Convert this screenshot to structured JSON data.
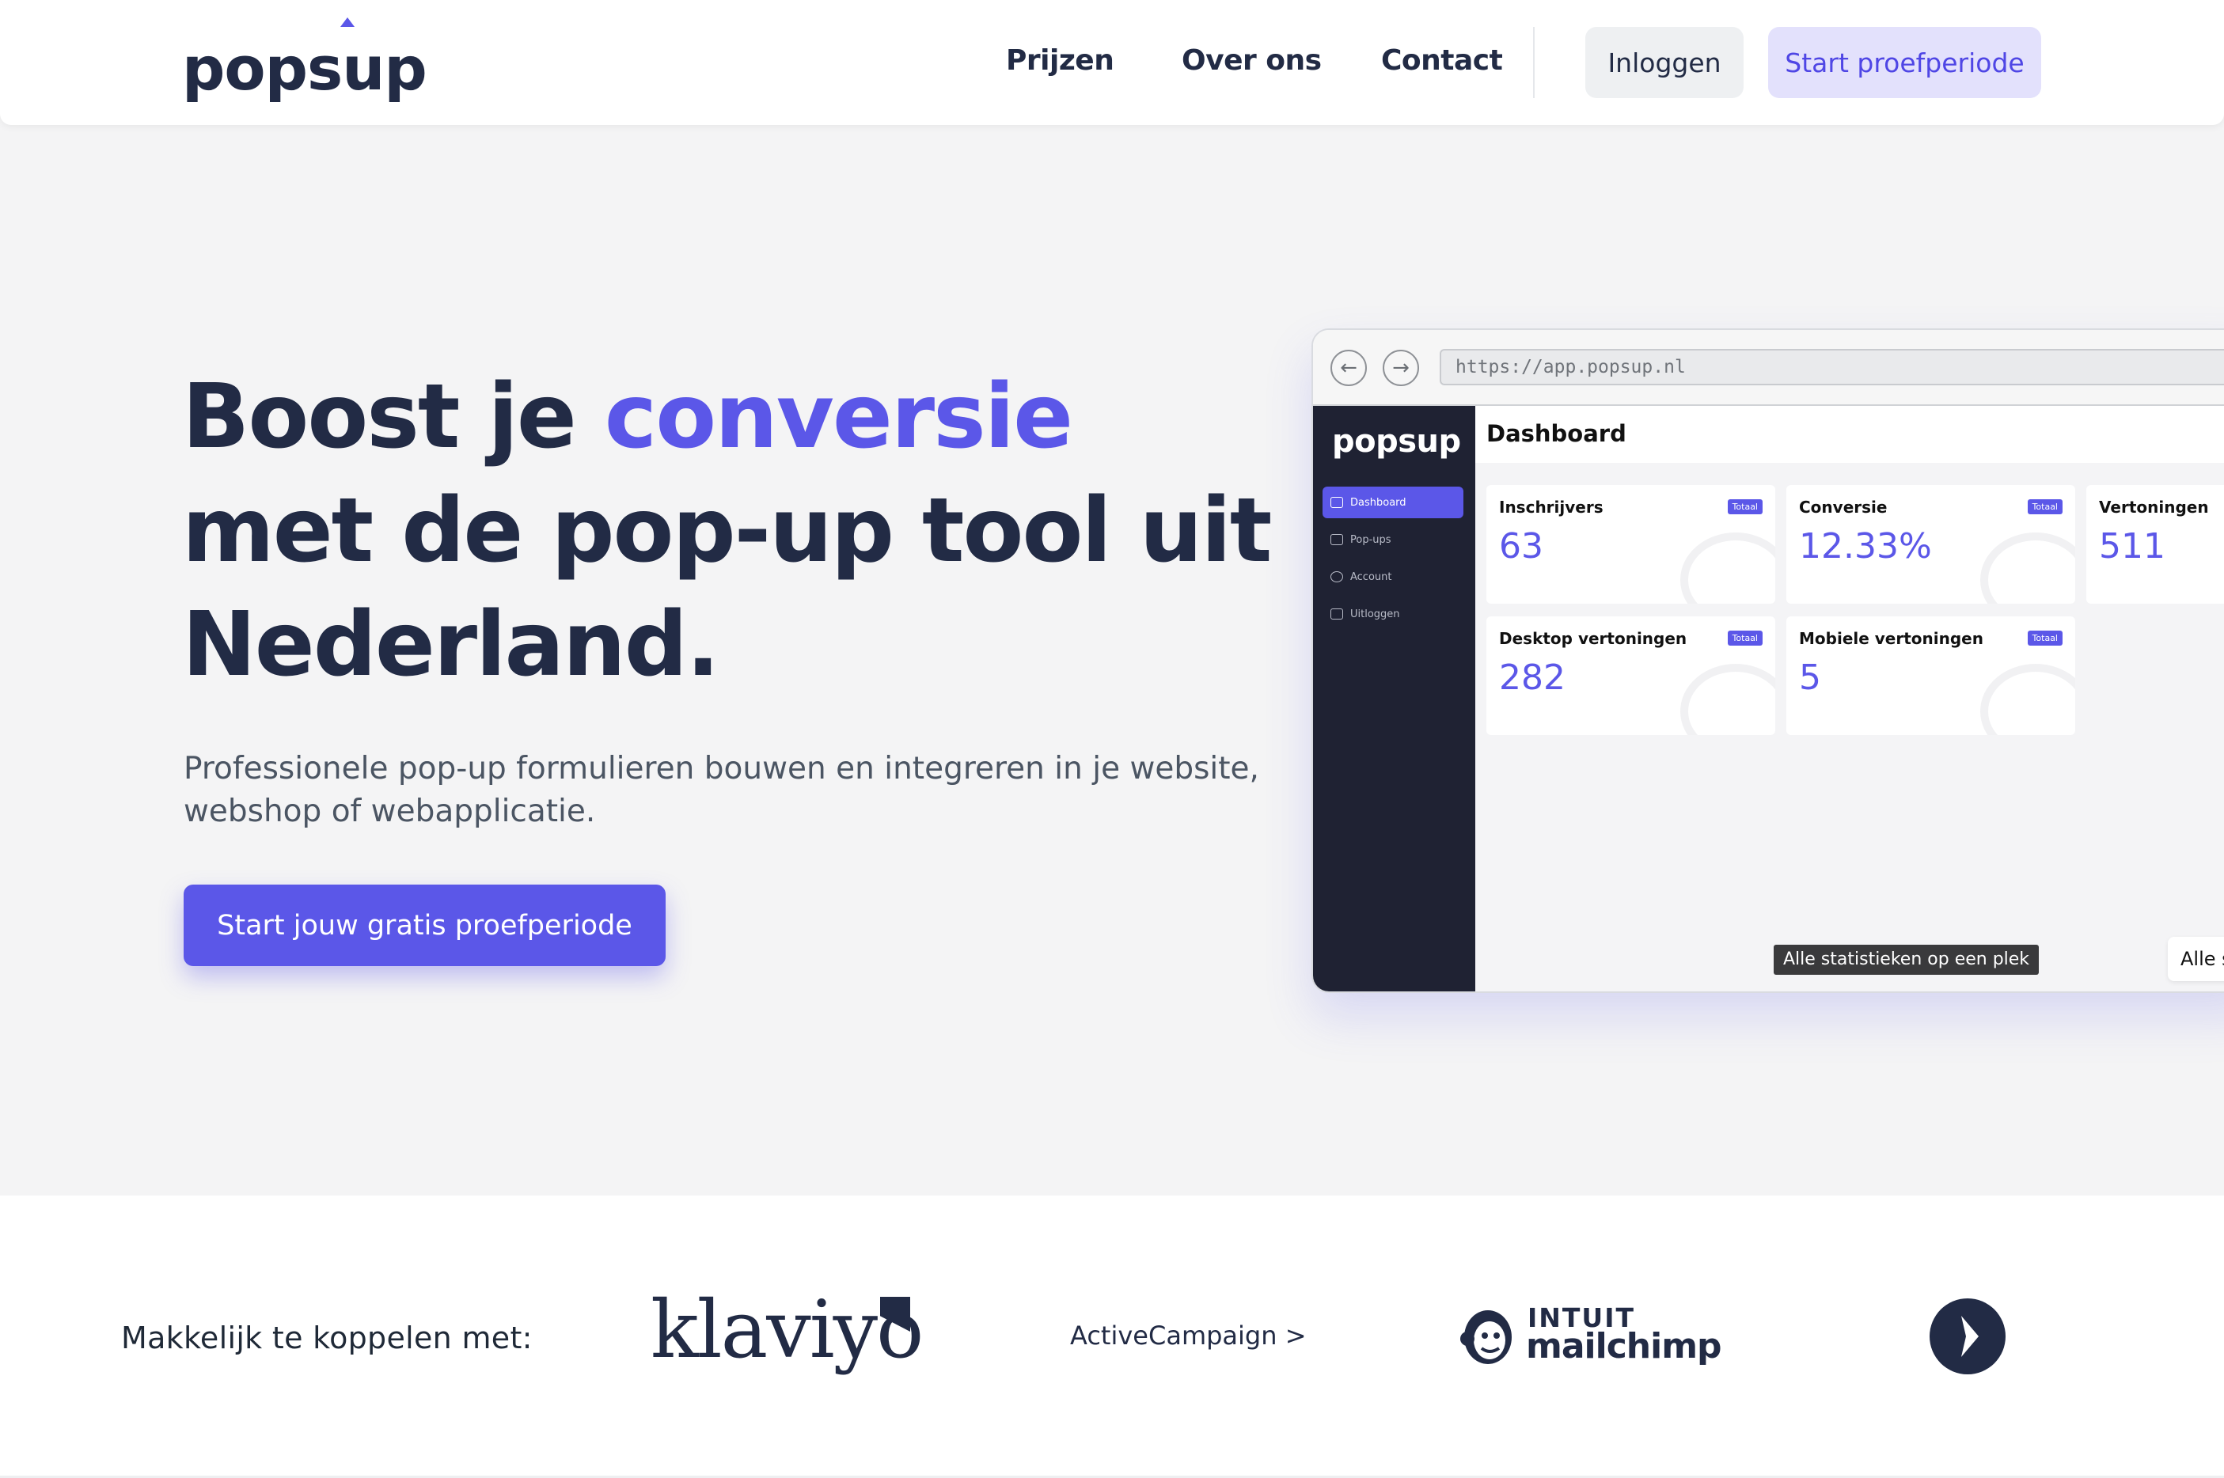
{
  "nav": {
    "logo": "popsup",
    "links": [
      "Prijzen",
      "Over ons",
      "Contact"
    ],
    "login": "Inloggen",
    "trial": "Start proefperiode"
  },
  "hero": {
    "title_start": "Boost je ",
    "title_accent": "conversie",
    "title_rest": "met de pop-up tool uit Nederland.",
    "subtitle": "Professionele pop-up formulieren bouwen en integreren in je website, webshop of webapplicatie.",
    "cta": "Start jouw gratis proefperiode"
  },
  "mockup": {
    "url": "https://app.popsup.nl",
    "logo": "popsup",
    "sidebar": [
      "Dashboard",
      "Pop-ups",
      "Account",
      "Uitloggen"
    ],
    "header": "Dashboard",
    "badge": "Totaal",
    "cards": [
      {
        "label": "Inschrijvers",
        "value": "63"
      },
      {
        "label": "Conversie",
        "value": "12.33%"
      },
      {
        "label": "Vertoningen",
        "value": "511"
      },
      {
        "label": "Desktop vertoningen",
        "value": "282"
      },
      {
        "label": "Mobiele vertoningen",
        "value": "5"
      }
    ],
    "tooltip": "Alle statistieken op een plek",
    "stats_button": "Alle statistieken"
  },
  "partners": {
    "label": "Makkelijk te koppelen met:",
    "klaviyo": "klaviyo",
    "activecampaign": "ActiveCampaign >",
    "intuit": "INTUIT",
    "mailchimp": "mailchimp"
  },
  "colors": {
    "accent": "#5b57e8",
    "dark": "#222b45",
    "background": "#f4f4f5"
  }
}
